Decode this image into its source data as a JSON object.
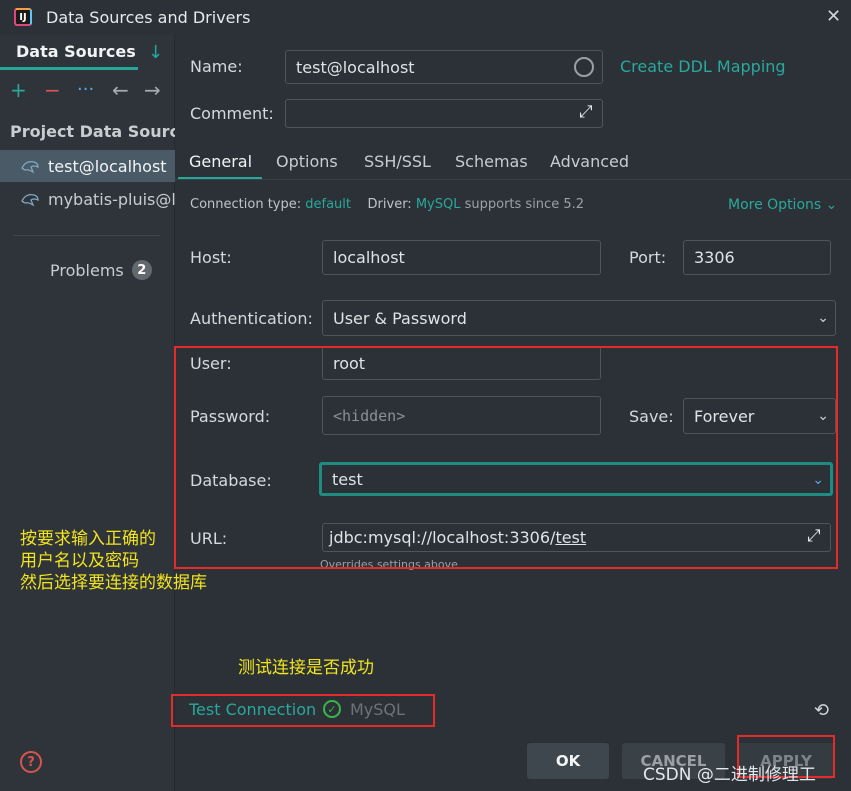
{
  "window": {
    "title": "Data Sources and Drivers",
    "close": "✕"
  },
  "sidebar": {
    "tab_label": "Data Sources",
    "toolbar": {
      "add": "+",
      "remove": "−",
      "more": "···",
      "back": "←",
      "forward": "→",
      "sort": "↓"
    },
    "section_title": "Project Data Sources",
    "items": [
      {
        "label": "test@localhost",
        "icon": "mysql-dolphin-icon"
      },
      {
        "label": "mybatis-pluis@lo",
        "icon": "mysql-dolphin-icon"
      }
    ],
    "problems": {
      "label": "Problems",
      "count": "2"
    },
    "help": "?"
  },
  "form": {
    "name_label": "Name:",
    "name_value": "test@localhost",
    "ddl_link": "Create DDL Mapping",
    "comment_label": "Comment:",
    "comment_value": "",
    "tabs": [
      "General",
      "Options",
      "SSH/SSL",
      "Schemas",
      "Advanced"
    ],
    "connection_type_label": "Connection type:",
    "connection_type_value": "default",
    "driver_label": "Driver:",
    "driver_value": "MySQL",
    "driver_suffix": "supports since 5.2",
    "more_options": "More Options",
    "host_label": "Host:",
    "host_value": "localhost",
    "port_label": "Port:",
    "port_value": "3306",
    "auth_label": "Authentication:",
    "auth_value": "User & Password",
    "user_label": "User:",
    "user_value": "root",
    "password_label": "Password:",
    "password_placeholder": "<hidden>",
    "save_label": "Save:",
    "save_value": "Forever",
    "database_label": "Database:",
    "database_value": "test",
    "url_label": "URL:",
    "url_prefix": "jdbc:mysql://localhost:3306/",
    "url_db": "test",
    "overrides_note": "Overrides settings above"
  },
  "footer": {
    "test_connection": "Test Connection",
    "test_driver": "MySQL",
    "ok": "OK",
    "cancel": "CANCEL",
    "apply": "APPLY"
  },
  "annotations": {
    "left_lines": [
      "按要求输入正确的",
      "用户名以及密码",
      "然后选择要连接的数据库"
    ],
    "test_note": "测试连接是否成功",
    "watermark": "CSDN @二进制修理工",
    "highlight_color": "#e52a2a",
    "note_color": "#f2e41d"
  },
  "colors": {
    "accent": "#24a89a",
    "background": "#2b3136"
  }
}
